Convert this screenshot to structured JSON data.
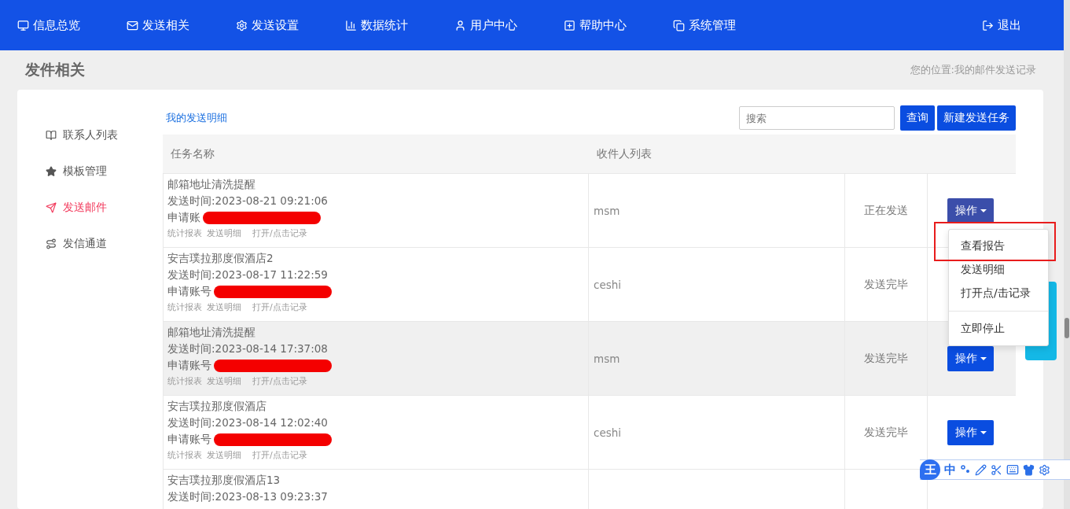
{
  "nav": {
    "items": [
      {
        "label": "信息总览"
      },
      {
        "label": "发送相关"
      },
      {
        "label": "发送设置"
      },
      {
        "label": "数据统计"
      },
      {
        "label": "用户中心"
      },
      {
        "label": "帮助中心"
      },
      {
        "label": "系统管理"
      }
    ],
    "logout": "退出"
  },
  "page": {
    "title": "发件相关",
    "breadcrumb": "您的位置:我的邮件发送记录"
  },
  "sidebar": {
    "items": [
      {
        "label": "联系人列表",
        "selected": false
      },
      {
        "label": "模板管理",
        "selected": false
      },
      {
        "label": "发送邮件",
        "selected": true
      },
      {
        "label": "发信通道",
        "selected": false
      }
    ]
  },
  "toolbar": {
    "link": "我的发送明细",
    "search_placeholder": "搜索",
    "query_button": "查询",
    "new_button": "新建发送任务"
  },
  "table": {
    "columns": [
      "任务名称",
      "收件人列表"
    ],
    "rows": [
      {
        "name": "邮箱地址清洗提醒",
        "time": "发送时间:2023-08-21 09:21:06",
        "account": "申请账",
        "links": [
          "统计报表",
          "发送明细",
          "打开/点击记录"
        ],
        "recipients": "msm",
        "status": "正在发送",
        "action": "操作",
        "highlighted": false,
        "open": true
      },
      {
        "name": "安吉璞拉那度假酒店2",
        "time": "发送时间:2023-08-17 11:22:59",
        "account": "申请账号",
        "links": [
          "统计报表",
          "发送明细",
          "打开/点击记录"
        ],
        "recipients": "ceshi",
        "status": "发送完毕",
        "highlighted": false
      },
      {
        "name": "邮箱地址清洗提醒",
        "time": "发送时间:2023-08-14 17:37:08",
        "account": "申请账号",
        "links": [
          "统计报表",
          "发送明细",
          "打开/点击记录"
        ],
        "recipients": "msm",
        "status": "发送完毕",
        "action": "操作",
        "highlighted": true,
        "open": false
      },
      {
        "name": "安吉璞拉那度假酒店",
        "time": "发送时间:2023-08-14 12:02:40",
        "account": "申请账号",
        "links": [
          "统计报表",
          "发送明细",
          "打开/点击记录"
        ],
        "recipients": "ceshi",
        "status": "发送完毕",
        "action": "操作",
        "highlighted": false,
        "open": false
      },
      {
        "name": "安吉璞拉那度假酒店13",
        "time": "发送时间:2023-08-13 09:23:37",
        "highlighted": false
      }
    ]
  },
  "dropdown": {
    "items": [
      {
        "label": "查看报告",
        "kind": "item"
      },
      {
        "label": "发送明细",
        "kind": "item"
      },
      {
        "label": "打开点/击记录",
        "kind": "item"
      },
      {
        "kind": "divider"
      },
      {
        "label": "立即停止",
        "kind": "item"
      }
    ]
  },
  "ime_toolbar": {
    "logo": "王",
    "mode": "中"
  }
}
